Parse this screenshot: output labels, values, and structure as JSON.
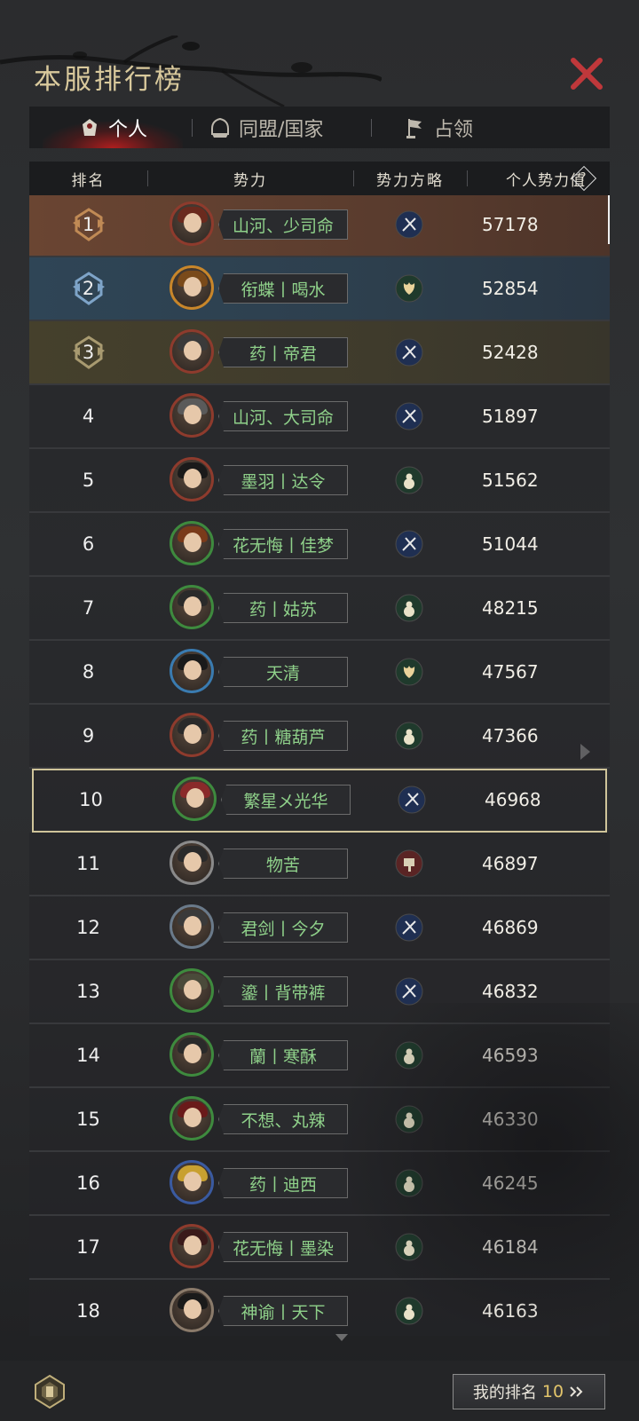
{
  "title": "本服排行榜",
  "tabs": [
    {
      "label": "个人",
      "icon": "person-emblem-icon",
      "active": true
    },
    {
      "label": "同盟/国家",
      "icon": "alliance-helmet-icon",
      "active": false
    },
    {
      "label": "占领",
      "icon": "flag-icon",
      "active": false
    }
  ],
  "columns": {
    "rank": "排名",
    "faction": "势力",
    "strategy": "势力方略",
    "power": "个人势力值"
  },
  "help_symbol": "?",
  "rows": [
    {
      "rank": "1",
      "name": "山河、少司命",
      "strategy": "swords",
      "power": "57178"
    },
    {
      "rank": "2",
      "name": "衔蝶丨喝水",
      "strategy": "lotus",
      "power": "52854"
    },
    {
      "rank": "3",
      "name": "药丨帝君",
      "strategy": "swords",
      "power": "52428"
    },
    {
      "rank": "4",
      "name": "山河、大司命",
      "strategy": "swords",
      "power": "51897"
    },
    {
      "rank": "5",
      "name": "墨羽丨达令",
      "strategy": "gourd",
      "power": "51562"
    },
    {
      "rank": "6",
      "name": "花无悔丨佳梦",
      "strategy": "swords",
      "power": "51044"
    },
    {
      "rank": "7",
      "name": "药丨姑苏",
      "strategy": "gourd",
      "power": "48215"
    },
    {
      "rank": "8",
      "name": "天清",
      "strategy": "lotus",
      "power": "47567"
    },
    {
      "rank": "9",
      "name": "药丨糖葫芦",
      "strategy": "gourd",
      "power": "47366"
    },
    {
      "rank": "10",
      "name": "繁星メ光华",
      "strategy": "swords",
      "power": "46968"
    },
    {
      "rank": "11",
      "name": "物苦",
      "strategy": "hammer",
      "power": "46897"
    },
    {
      "rank": "12",
      "name": "君剑丨今夕",
      "strategy": "swords",
      "power": "46869"
    },
    {
      "rank": "13",
      "name": "鎏丨背带裤",
      "strategy": "swords",
      "power": "46832"
    },
    {
      "rank": "14",
      "name": "蘭丨寒酥",
      "strategy": "gourd",
      "power": "46593"
    },
    {
      "rank": "15",
      "name": "不想、丸辣",
      "strategy": "gourd",
      "power": "46330"
    },
    {
      "rank": "16",
      "name": "药丨迪西",
      "strategy": "gourd",
      "power": "46245"
    },
    {
      "rank": "17",
      "name": "花无悔丨墨染",
      "strategy": "gourd",
      "power": "46184"
    },
    {
      "rank": "18",
      "name": "神谕丨天下",
      "strategy": "gourd",
      "power": "46163"
    }
  ],
  "my_rank": {
    "label": "我的排名",
    "value": "10"
  },
  "colors": {
    "accent_gold": "#d9c99c",
    "name_green": "#8fd18a",
    "close_red": "#c0383b",
    "rank_value_gold": "#e3c56b"
  }
}
